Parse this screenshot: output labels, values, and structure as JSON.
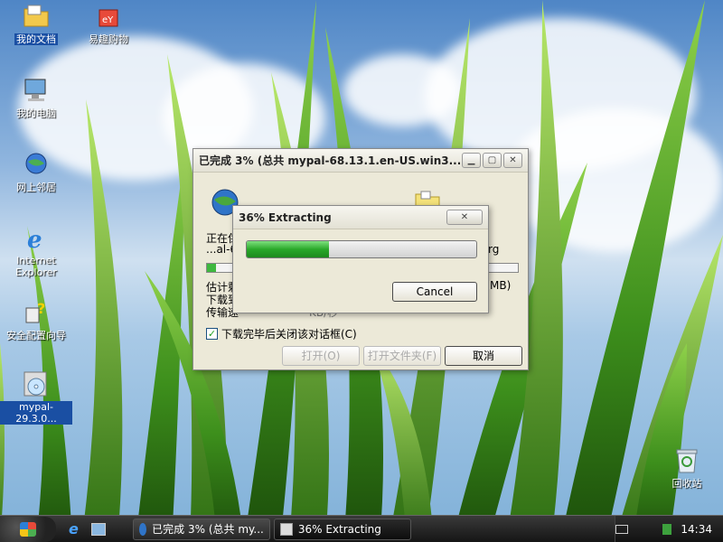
{
  "desktop": {
    "icons": [
      {
        "label": "我的文档"
      },
      {
        "label": "易趣购物"
      },
      {
        "label": "我的电脑"
      },
      {
        "label": "网上邻居"
      },
      {
        "label": "Internet Explorer"
      },
      {
        "label": "安全配置向导"
      },
      {
        "label": "mypal-29.3.0..."
      },
      {
        "label": "回收站"
      }
    ]
  },
  "download_window": {
    "title": "已完成 3% (总共 mypal-68.13.1.en-US.win3...",
    "line1": "正在保",
    "line2": "...al-6",
    "line2_tail": "rg",
    "est_label": "估计剩",
    "est_tail": "MB)",
    "dl_label": "下载到",
    "rate_label": "传输速",
    "rate_tail": "KB/秒",
    "progress_percent": 3,
    "close_checkbox_label": "下载完毕后关闭该对话框(C)",
    "close_checkbox_checked": true,
    "open_label": "打开(O)",
    "open_folder_label": "打开文件夹(F)",
    "cancel_label": "取消"
  },
  "extract_window": {
    "title": "36% Extracting",
    "progress_percent": 36,
    "cancel_label": "Cancel"
  },
  "taskbar": {
    "tasks": [
      {
        "label": "已完成 3% (总共 my..."
      },
      {
        "label": "36% Extracting"
      }
    ],
    "clock": "14:34"
  }
}
